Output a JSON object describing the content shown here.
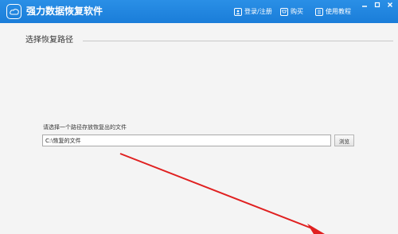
{
  "app": {
    "title": "强力数据恢复软件"
  },
  "toolbar": {
    "login_label": "登录/注册",
    "buy_label": "购买",
    "tutorial_label": "使用教程"
  },
  "window_controls": {
    "minimize": "—",
    "maximize": "□",
    "close": "✕"
  },
  "section": {
    "title": "选择恢复路径"
  },
  "path_form": {
    "prompt": "请选择一个路径存放恢复出的文件",
    "path_value": "C:\\恢复的文件",
    "browse_label": "浏览"
  },
  "colors": {
    "titlebar": "#1a7dd9",
    "panel_background": "#f4f4f4",
    "annotation_arrow": "#e02020"
  },
  "icons": {
    "app_logo": "cloud-drive-icon",
    "login": "user-icon",
    "buy": "cart-icon",
    "tutorial": "book-icon"
  }
}
